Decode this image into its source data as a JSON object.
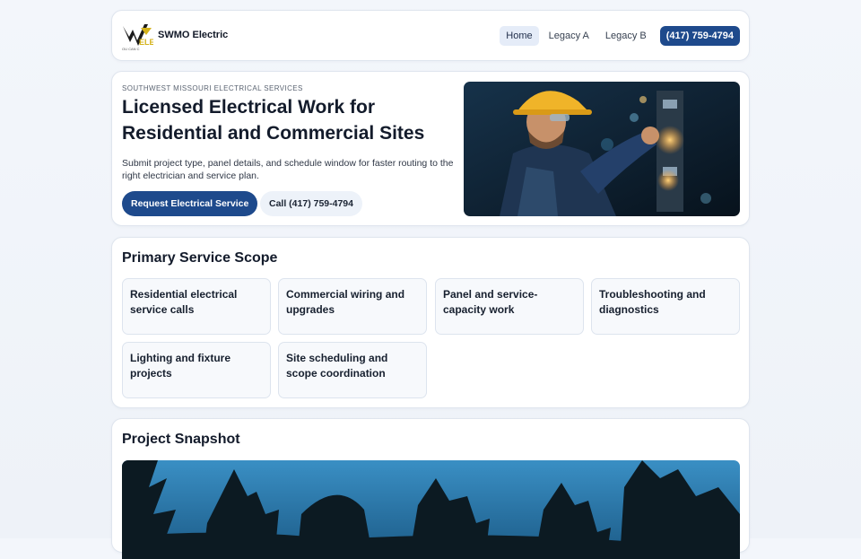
{
  "header": {
    "brand": "SWMO Electric",
    "logo_text": "ELE",
    "logo_sub": "OU CAN C",
    "nav": [
      {
        "label": "Home",
        "active": true
      },
      {
        "label": "Legacy A",
        "active": false
      },
      {
        "label": "Legacy B",
        "active": false
      }
    ],
    "phone_button": "(417) 759-4794"
  },
  "hero": {
    "eyebrow": "SOUTHWEST MISSOURI ELECTRICAL SERVICES",
    "title": "Licensed Electrical Work for Residential and Commercial Sites",
    "description": "Submit project type, panel details, and schedule window for faster routing to the right electrician and service plan.",
    "primary_cta": "Request Electrical Service",
    "secondary_cta": "Call (417) 759-4794"
  },
  "services": {
    "title": "Primary Service Scope",
    "items": [
      "Residential electrical service calls",
      "Commercial wiring and upgrades",
      "Panel and service-capacity work",
      "Troubleshooting and diagnostics",
      "Lighting and fixture projects",
      "Site scheduling and scope coordination"
    ]
  },
  "snapshot": {
    "title": "Project Snapshot"
  },
  "colors": {
    "accent": "#1e4a8c",
    "page_bg": "#f1f4f9",
    "card_bg": "#ffffff"
  }
}
